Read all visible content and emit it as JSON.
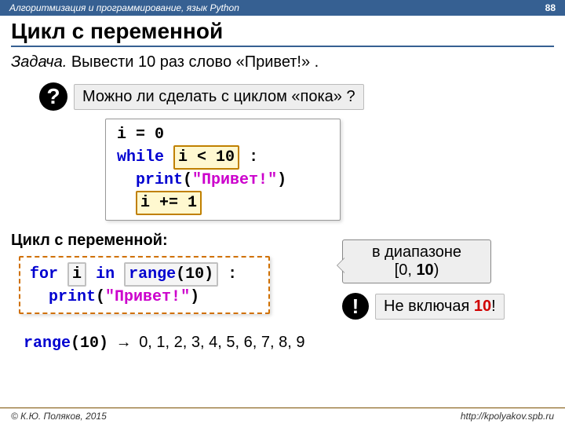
{
  "header": {
    "course": "Алгоритмизация и программирование, язык Python",
    "page": "88"
  },
  "title": "Цикл с переменной",
  "task": {
    "label": "Задача.",
    "text": "Вывести 10 раз слово «Привет!» ."
  },
  "question": {
    "mark": "?",
    "text": "Можно ли сделать с циклом «пока» ?"
  },
  "code_while": {
    "l1a": "i = ",
    "l1b": "0",
    "l2a": "while",
    "l2b": "i < ",
    "l2c": "10",
    "l2d": " :",
    "l3a": "print",
    "l3b": "(",
    "l3c": "\"Привет!\"",
    "l3d": ")",
    "l4a": "i += ",
    "l4b": "1"
  },
  "subtitle": "Цикл с переменной:",
  "code_for": {
    "l1a": "for",
    "l1b": "i",
    "l1c": "in",
    "l1d": "range",
    "l1e": "(",
    "l1f": "10",
    "l1g": ")",
    "l1h": ":",
    "l2a": "print",
    "l2b": "(",
    "l2c": "\"Привет!\"",
    "l2d": ")"
  },
  "range_callout": {
    "line1": "в диапазоне",
    "line2a": "[0, ",
    "line2b": "10",
    "line2c": ")"
  },
  "exclamation": {
    "mark": "!",
    "text_a": "Не включая ",
    "text_b": "10",
    "text_c": "!"
  },
  "result": {
    "code": "range",
    "paren_open": "(",
    "arg": "10",
    "paren_close": ")",
    "arrow": "→",
    "values": "0, 1, 2, 3, 4, 5, 6, 7, 8, 9"
  },
  "footer": {
    "left": "© К.Ю. Поляков, 2015",
    "right": "http://kpolyakov.spb.ru"
  }
}
